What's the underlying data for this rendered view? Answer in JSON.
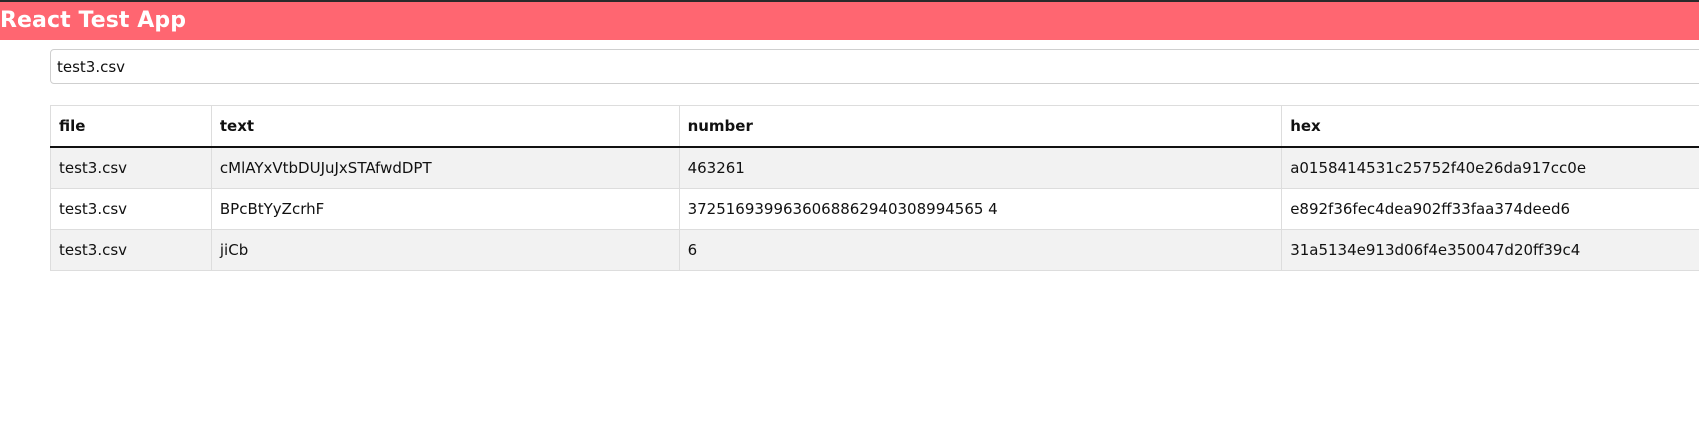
{
  "app": {
    "title": "React Test App"
  },
  "search": {
    "value": "test3.csv"
  },
  "table": {
    "columns": [
      "file",
      "text",
      "number",
      "hex"
    ],
    "rows": [
      {
        "file": "test3.csv",
        "text": "cMlAYxVtbDUJuJxSTAfwdDPT",
        "number": "463261",
        "hex": "a0158414531c25752f40e26da917cc0e"
      },
      {
        "file": "test3.csv",
        "text": "BPcBtYyZcrhF",
        "number": "3725169399636068862940308994565 4",
        "hex": "e892f36fec4dea902ff33faa374deed6"
      },
      {
        "file": "test3.csv",
        "text": "jiCb",
        "number": "6",
        "hex": "31a5134e913d06f4e350047d20ff39c4"
      }
    ]
  },
  "colors": {
    "header_bg": "#ff6671",
    "header_text": "#ffffff",
    "stripe": "#f2f2f2"
  }
}
